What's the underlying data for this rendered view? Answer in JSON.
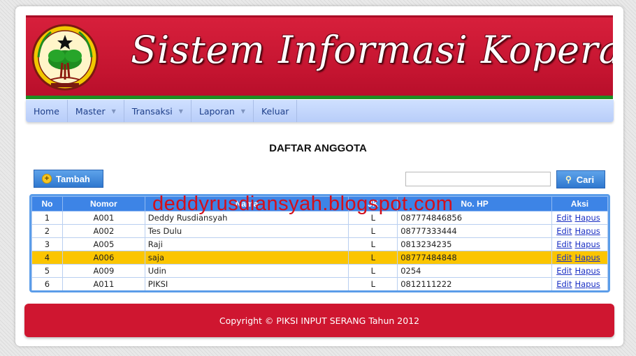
{
  "header": {
    "title": "Sistem Informasi Koperasi",
    "logo_caption": "KOPERASI RUSDIANSYAH"
  },
  "nav": {
    "items": [
      {
        "label": "Home",
        "has_dropdown": false
      },
      {
        "label": "Master",
        "has_dropdown": true
      },
      {
        "label": "Transaksi",
        "has_dropdown": true
      },
      {
        "label": "Laporan",
        "has_dropdown": true
      },
      {
        "label": "Keluar",
        "has_dropdown": false
      }
    ]
  },
  "page": {
    "heading": "DAFTAR ANGGOTA"
  },
  "toolbar": {
    "add_label": "Tambah",
    "search_label": "Cari",
    "search_value": ""
  },
  "table": {
    "columns": [
      "No",
      "Nomor",
      "Nama",
      "JK",
      "No. HP",
      "Aksi"
    ],
    "rows": [
      {
        "no": "1",
        "nomor": "A001",
        "nama": "Deddy Rusdiansyah",
        "jk": "L",
        "hp": "087774846856",
        "highlight": false
      },
      {
        "no": "2",
        "nomor": "A002",
        "nama": "Tes Dulu",
        "jk": "L",
        "hp": "08777333444",
        "highlight": false
      },
      {
        "no": "3",
        "nomor": "A005",
        "nama": "Raji",
        "jk": "L",
        "hp": "0813234235",
        "highlight": false
      },
      {
        "no": "4",
        "nomor": "A006",
        "nama": "saja",
        "jk": "L",
        "hp": "08777484848",
        "highlight": true
      },
      {
        "no": "5",
        "nomor": "A009",
        "nama": "Udin",
        "jk": "L",
        "hp": "0254",
        "highlight": false
      },
      {
        "no": "6",
        "nomor": "A011",
        "nama": "PIKSI",
        "jk": "L",
        "hp": "0812111222",
        "highlight": false
      }
    ],
    "edit_label": "Edit",
    "delete_label": "Hapus"
  },
  "watermark": "deddyrusdiansyah.blogspot.com",
  "footer": {
    "text": "Copyright © PIKSI INPUT SERANG Tahun 2012"
  },
  "colors": {
    "banner": "#c41430",
    "nav": "#c4d6fc",
    "table_header": "#3d84e6",
    "highlight_row": "#fbc500",
    "footer": "#cf1630",
    "accent_green": "#1e8e22"
  },
  "icons": {
    "add": "plus-circle-icon",
    "search": "magnifier-icon",
    "dropdown": "caret-down-icon",
    "logo": "emblem-logo"
  }
}
